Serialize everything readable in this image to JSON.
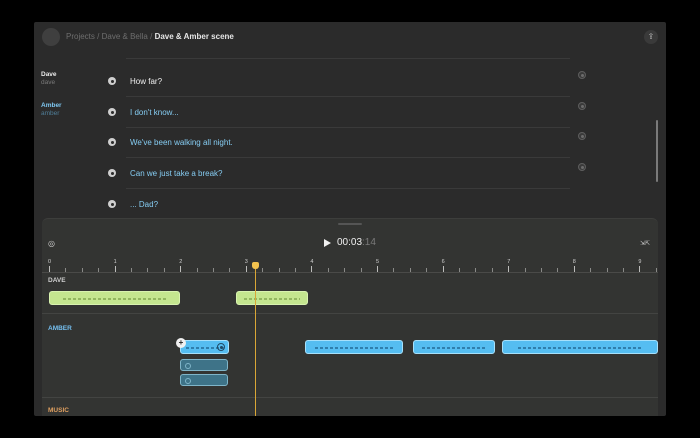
{
  "breadcrumb": {
    "root": "Projects",
    "sep1": "/",
    "project": "Dave & Bella",
    "sep2": "/",
    "current": "Dave & Amber scene"
  },
  "speakers": [
    {
      "name": "Dave",
      "handle": "dave"
    },
    {
      "name": "Amber",
      "handle": "amber"
    }
  ],
  "script_lines": [
    {
      "speaker": "dave",
      "text": "How far?"
    },
    {
      "speaker": "amber",
      "text": "I don't know..."
    },
    {
      "speaker": "amber",
      "text": "We've been walking all night."
    },
    {
      "speaker": "amber",
      "text": "Can we just take a break?"
    },
    {
      "speaker": "amber",
      "text": "... Dad?"
    }
  ],
  "transport": {
    "time_main": "00:03",
    "time_frames": ":14",
    "playhead_seconds": 3.14
  },
  "ruler_labels": [
    "0",
    "1",
    "2",
    "3",
    "4",
    "5",
    "6",
    "7",
    "8",
    "9"
  ],
  "tracks": {
    "dave": "DAVE",
    "amber": "AMBER",
    "music": "MUSIC"
  },
  "clips": {
    "dave": [
      {
        "start": 0.0,
        "end": 2.0
      },
      {
        "start": 2.85,
        "end": 3.95
      }
    ],
    "amber": [
      {
        "start": 2.0,
        "end": 2.75
      },
      {
        "start": 3.9,
        "end": 5.4
      },
      {
        "start": 5.55,
        "end": 6.8
      },
      {
        "start": 6.9,
        "end": 9.3
      }
    ]
  },
  "icons": {
    "share": "share-icon",
    "loop": "loop-icon",
    "zoom": "zoom-icon",
    "play": "play-icon"
  },
  "colors": {
    "dave_clip": "#c4e68f",
    "amber_clip": "#55bdf1",
    "amber_label": "#75bff0",
    "music_label": "#e0a060",
    "playhead": "#f2c24e"
  }
}
